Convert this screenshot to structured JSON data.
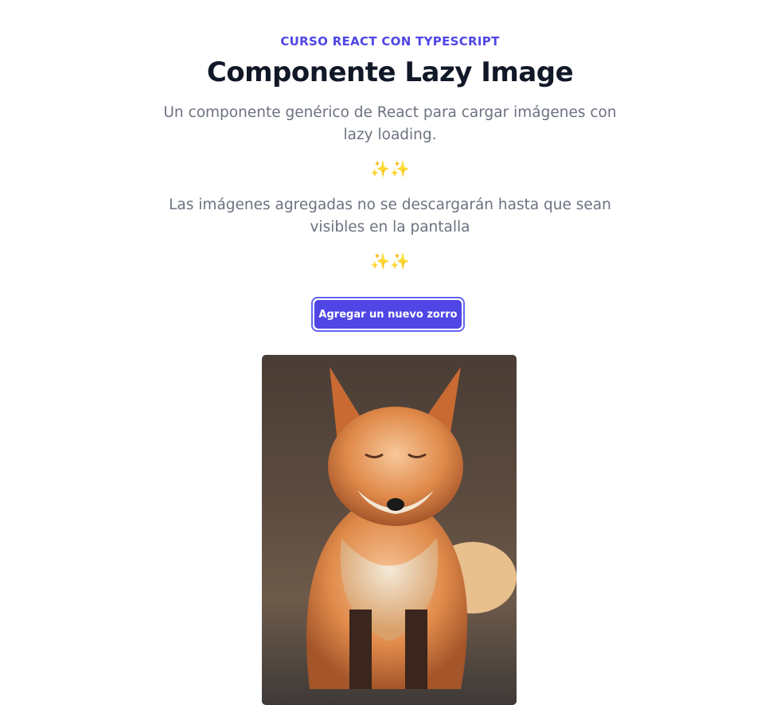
{
  "header": {
    "eyebrow": "CURSO REACT CON TYPESCRIPT",
    "title": "Componente Lazy Image",
    "description": "Un componente genérico de React para cargar imágenes con lazy loading.",
    "sparkles_1": "✨✨",
    "note": "Las imágenes agregadas no se descargarán hasta que sean visibles en la pantalla",
    "sparkles_2": "✨✨"
  },
  "actions": {
    "add_fox_label": "Agregar un nuevo zorro"
  },
  "colors": {
    "accent": "#4f46e5",
    "title": "#111827",
    "body_text": "#6b7280"
  }
}
